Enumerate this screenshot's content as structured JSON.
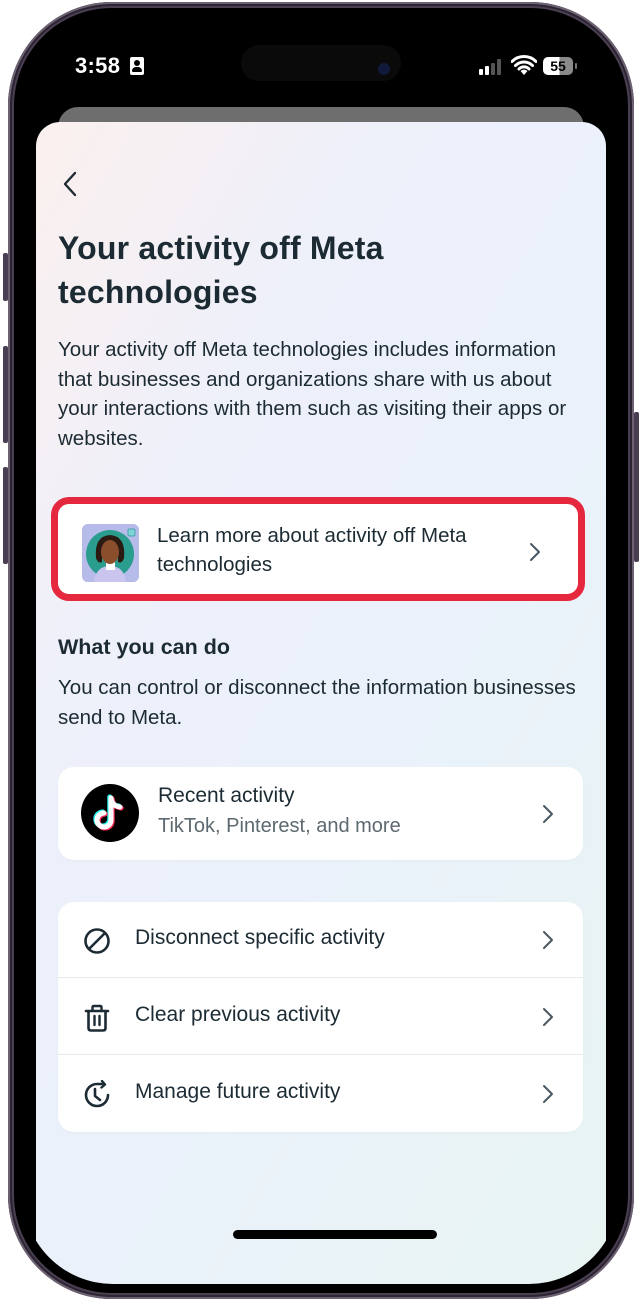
{
  "status_bar": {
    "time": "3:58",
    "battery_level": "55",
    "icons": [
      "contact-card-icon",
      "cellular-signal-icon",
      "wifi-icon",
      "battery-icon"
    ]
  },
  "page": {
    "back_icon": "chevron-left-icon",
    "title": "Your activity off Meta technologies",
    "description": "Your activity off Meta technologies includes information that businesses and organizations share with us about your interactions with them such as visiting their apps or websites."
  },
  "learn_more": {
    "label": "Learn more about activity off Meta technologies",
    "icon": "illustrated-avatar-icon",
    "highlight_color": "#e5283e"
  },
  "what_you_can_do": {
    "title": "What you can do",
    "description": "You can control or disconnect the information businesses send to Meta."
  },
  "recent_activity": {
    "title": "Recent activity",
    "subtitle": "TikTok, Pinterest, and more",
    "icon": "tiktok-icon"
  },
  "actions": [
    {
      "label": "Disconnect specific activity",
      "icon": "disconnect-icon"
    },
    {
      "label": "Clear previous activity",
      "icon": "trash-icon"
    },
    {
      "label": "Manage future activity",
      "icon": "clock-refresh-icon"
    }
  ],
  "colors": {
    "text_primary": "#1c2b33",
    "text_secondary": "#5c6970",
    "card_background": "#ffffff"
  }
}
